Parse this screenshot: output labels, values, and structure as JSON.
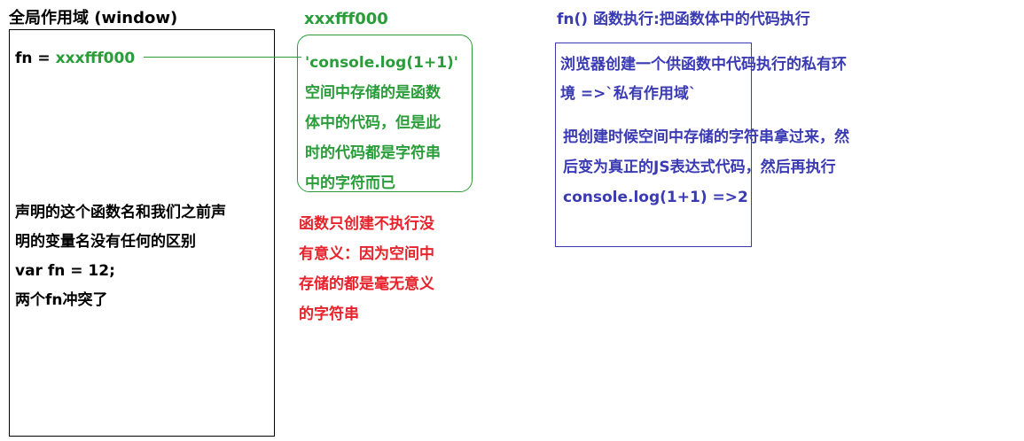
{
  "global_scope": {
    "title": "全局作用域 (window)",
    "fn_name": "fn = ",
    "fn_address": "xxxfff000",
    "note_lines": [
      "声明的这个函数名和我们之前声",
      "明的变量名没有任何的区别",
      "var fn = 12;",
      "两个fn冲突了"
    ]
  },
  "heap": {
    "address": "xxxfff000",
    "content_lines": [
      "'console.log(1+1)'",
      "空间中存储的是函数",
      "体中的代码，但是此",
      "时的代码都是字符串",
      "中的字符而已"
    ]
  },
  "red_note": {
    "lines": [
      "函数只创建不执行没",
      "有意义：因为空间中",
      "存储的都是毫无意义",
      "的字符串"
    ]
  },
  "execution": {
    "title": "fn() 函数执行:把函数体中的代码执行",
    "paragraph1_lines": [
      "浏览器创建一个供函数中代码执行的私有环",
      "境 =>`私有作用域`"
    ],
    "paragraph2_lines": [
      "把创建时候空间中存储的字符串拿过来，然",
      "后变为真正的JS表达式代码，然后再执行",
      "console.log(1+1) =>2"
    ]
  },
  "colors": {
    "green": "#2a9d3a",
    "red": "#e8222b",
    "blue": "#3a3ab3",
    "black": "#000000"
  }
}
